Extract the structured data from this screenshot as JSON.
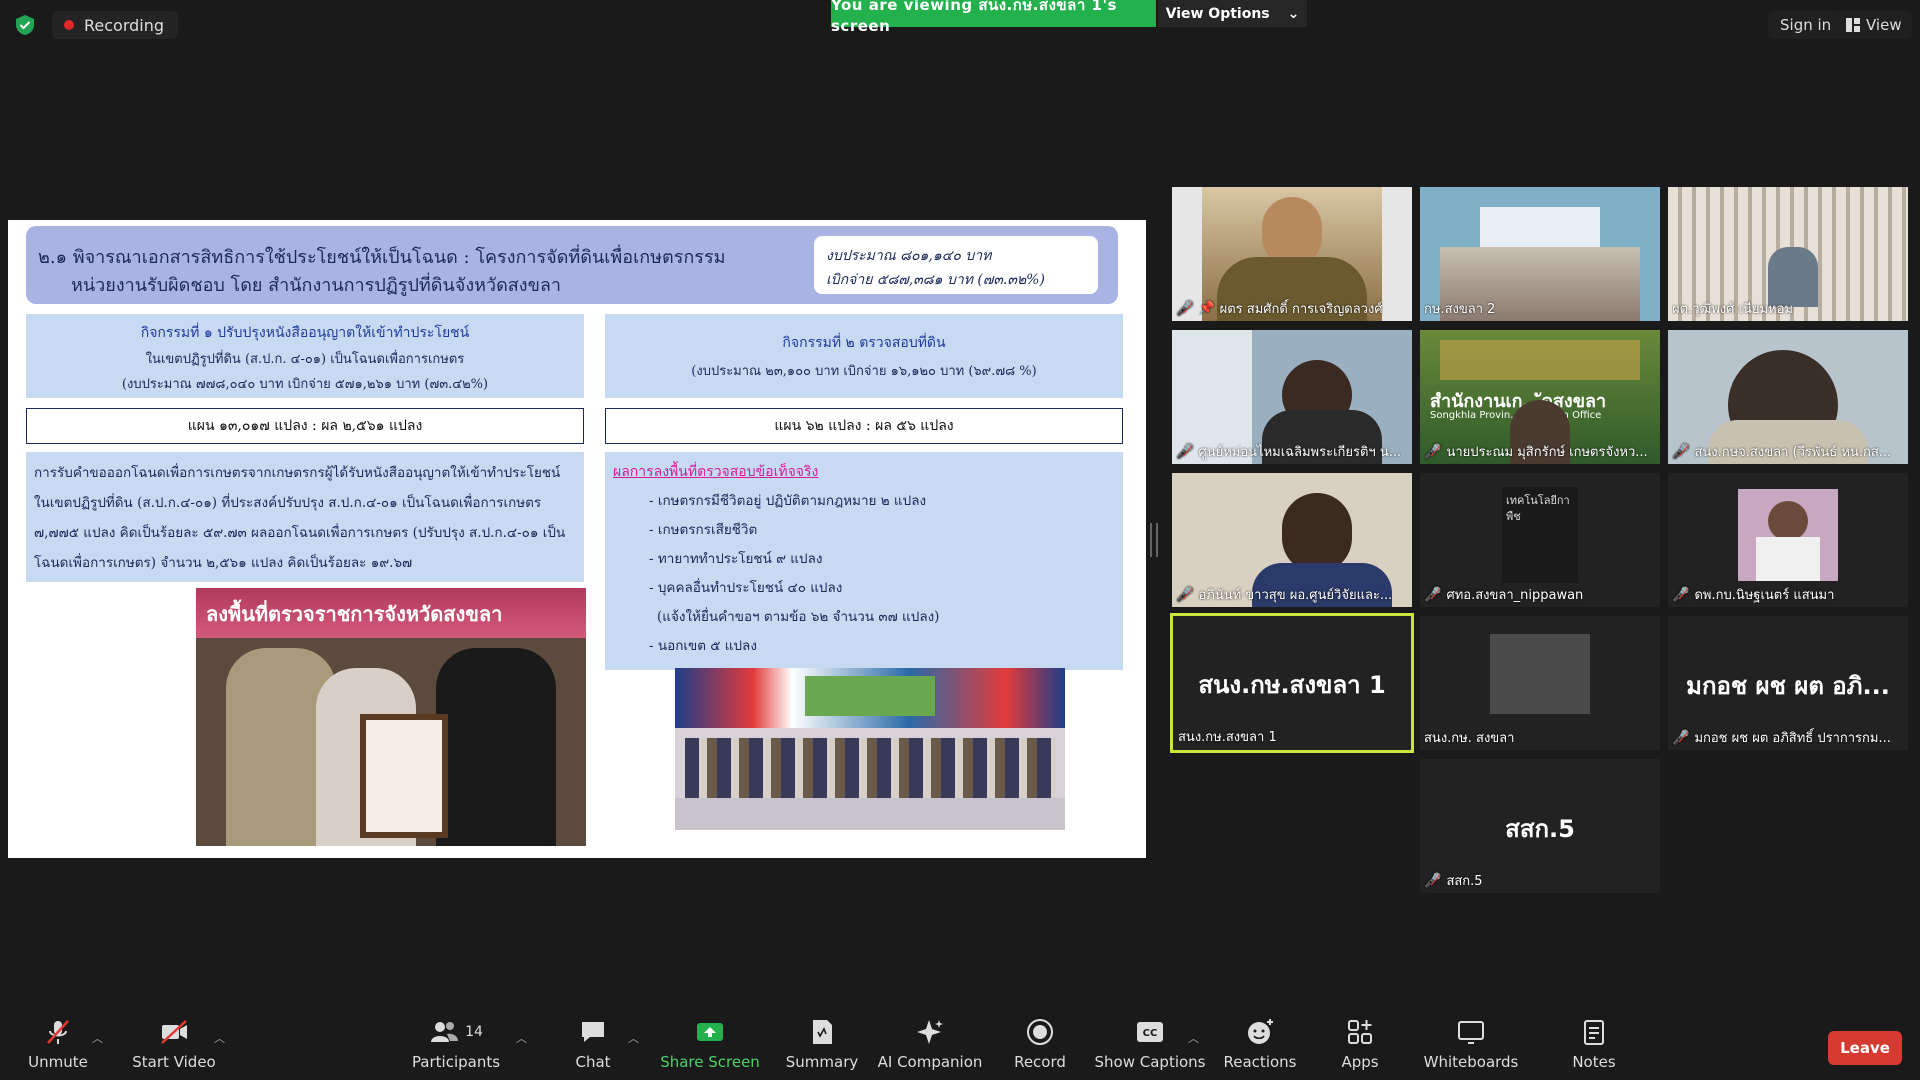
{
  "topbar": {
    "recording_label": "Recording",
    "viewing_banner": "You are viewing สนง.กษ.สงขลา 1's screen",
    "view_options_label": "View Options",
    "signin_label": "Sign in",
    "view_label": "View"
  },
  "slide": {
    "title_line1": "๒.๑ พิจารณาเอกสารสิทธิการใช้ประโยชน์ให้เป็นโฉนด : โครงการจัดที่ดินเพื่อเกษตรกรรม",
    "title_line2": "หน่วยงานรับผิดชอบ โดย สำนักงานการปฏิรูปที่ดินจังหวัดสงขลา",
    "budget_line1": "งบประมาณ ๘๐๑,๑๔๐ บาท",
    "budget_line2": "เบิกจ่าย   ๕๘๗,๓๘๑ บาท (๗๓.๓๒%)",
    "act1_title": "กิจกรรมที่ ๑ ปรับปรุงหนังสืออนุญาตให้เข้าทำประโยชน์",
    "act1_line2": "ในเขตปฏิรูปที่ดิน (ส.ป.ก. ๔-๐๑) เป็นโฉนดเพื่อการเกษตร",
    "act1_line3": "(งบประมาณ ๗๗๘,๐๔๐ บาท เบิกจ่าย ๕๗๑,๒๖๑ บาท (๗๓.๔๒%)",
    "act1_plan": "แผน  ๑๓,๐๑๗ แปลง : ผล ๒,๕๖๑ แปลง",
    "act1_body": "การรับคำขอออกโฉนดเพื่อการเกษตรจากเกษตรกรผู้ได้รับหนังสืออนุญาตให้เข้าทำประโยชน์ ในเขตปฏิรูปที่ดิน (ส.ป.ก.๔-๐๑) ที่ประสงค์ปรับปรุง ส.ป.ก.๔-๐๑ เป็นโฉนดเพื่อการเกษตร ๗,๗๗๕ แปลง คิดเป็นร้อยละ ๕๙.๗๓ ผลออกโฉนดเพื่อการเกษตร (ปรับปรุง ส.ป.ก.๔-๐๑ เป็นโฉนดเพื่อการเกษตร) จำนวน ๒,๕๖๑ แปลง คิดเป็นร้อยละ ๑๙.๖๗",
    "act2_title": "กิจกรรมที่ ๒ ตรวจสอบที่ดิน",
    "act2_line2": "(งบประมาณ ๒๓,๑๐๐ บาท เบิกจ่าย ๑๖,๑๒๐ บาท (๖๙.๗๘ %)",
    "act2_plan": "แผน  ๖๒  แปลง : ผล ๕๖  แปลง",
    "act2_heading": "ผลการลงพื้นที่ตรวจสอบข้อเท็จจริง",
    "act2_bullets": [
      "- เกษตรกรมีชีวิตอยู่ ปฏิบัติตามกฎหมาย ๒ แปลง",
      "- เกษตรกรเสียชีวิต",
      "- ทายาททำประโยชน์ ๙ แปลง",
      "- บุคคลอื่นทำประโยชน์ ๔๐ แปลง",
      "  (แจ้งให้ยื่นคำขอฯ ตามข้อ ๖๒ จำนวน ๓๗ แปลง)",
      "- นอกเขต ๕ แปลง"
    ],
    "photo1_banner": "ลงพื้นที่ตรวจราชการจังหวัดสงขลา"
  },
  "tiles": [
    {
      "name": "ผตร สมศักดิ์ การเจริญดลวงศ์",
      "muted": true,
      "pinned": true
    },
    {
      "name": "กษ.สงขลา 2",
      "muted": false
    },
    {
      "name": "ผต.วุฒิพงศ์ เนียมหอม",
      "muted": false
    },
    {
      "name": "ศูนย์หม่อนไหมเฉลิมพระเกียรติฯ น...",
      "muted": true
    },
    {
      "name": "นายประณม มุสิกรักษ์ เกษตรจังหว...",
      "muted": true,
      "bg_text": "สำนักงานเก...ัดสงขลา",
      "bg_text2": "Songkhla Provin...Extension Office"
    },
    {
      "name": "สนง.กษจ.สงขลา (วีรพันธ์ หน.กส...",
      "muted": true
    },
    {
      "name": "อภินันท์ ขาวสุข ผอ.ศูนย์วิจัยและ...",
      "muted": true
    },
    {
      "name": "ศทอ.สงขลา_nippawan",
      "muted": true,
      "bg_text": "เทคโนโลยีกา",
      "bg_text2": "พืช"
    },
    {
      "name": "ดพ.กบ.นิษฐเนตร์ แสนมา",
      "muted": true
    },
    {
      "name": "สนง.กษ.สงขลา 1",
      "muted": false,
      "big": "สนง.กษ.สงขลา 1"
    },
    {
      "name": "สนง.กษ. สงขลา",
      "muted": false
    },
    {
      "name": "มกอช ผช ผต อภิสิทธิ์ ปราการกม...",
      "muted": true,
      "big": "มกอช ผช ผต อภิ..."
    },
    {
      "name": "สสก.5",
      "muted": true,
      "big": "สสก.5"
    }
  ],
  "toolbar": {
    "unmute": "Unmute",
    "start_video": "Start Video",
    "participants": "Participants",
    "participants_count": "14",
    "chat": "Chat",
    "share_screen": "Share Screen",
    "summary": "Summary",
    "ai_companion": "AI Companion",
    "record": "Record",
    "show_captions": "Show Captions",
    "reactions": "Reactions",
    "apps": "Apps",
    "whiteboards": "Whiteboards",
    "notes": "Notes",
    "leave": "Leave"
  },
  "colors": {
    "accent_green": "#22b14c",
    "leave_red": "#d43a2f",
    "active_speaker": "#c8e63a",
    "muted_red": "#e53935"
  }
}
